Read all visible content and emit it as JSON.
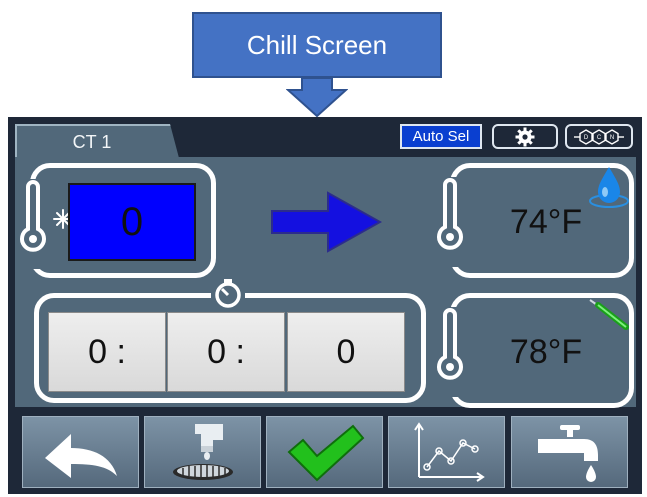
{
  "callout": {
    "label": "Chill Screen"
  },
  "header": {
    "tab_label": "CT 1",
    "auto_sel_label": "Auto Sel"
  },
  "setpoint": {
    "value": "0"
  },
  "timer": {
    "hours": "0 :",
    "minutes": "0 :",
    "seconds": "0"
  },
  "temperatures": {
    "temp1": "74°F",
    "temp2": "78°F"
  },
  "icons": {
    "settings": "gear-icon",
    "dcn": "dcn-icon",
    "water_drop": "water-drop-icon",
    "probe": "probe-icon",
    "snowflake_thermometer": "snowflake-thermometer-icon",
    "stopwatch": "stopwatch-icon",
    "direction_arrow": "right-arrow-icon"
  },
  "toolbar": {
    "buttons": [
      "back",
      "drain",
      "confirm",
      "graph",
      "fill"
    ]
  },
  "colors": {
    "callout": "#4472c4",
    "setpoint_box": "#0000ff",
    "auto_sel": "#0a3fd0",
    "panel": "#51687a",
    "confirm_check": "#22c01c"
  }
}
